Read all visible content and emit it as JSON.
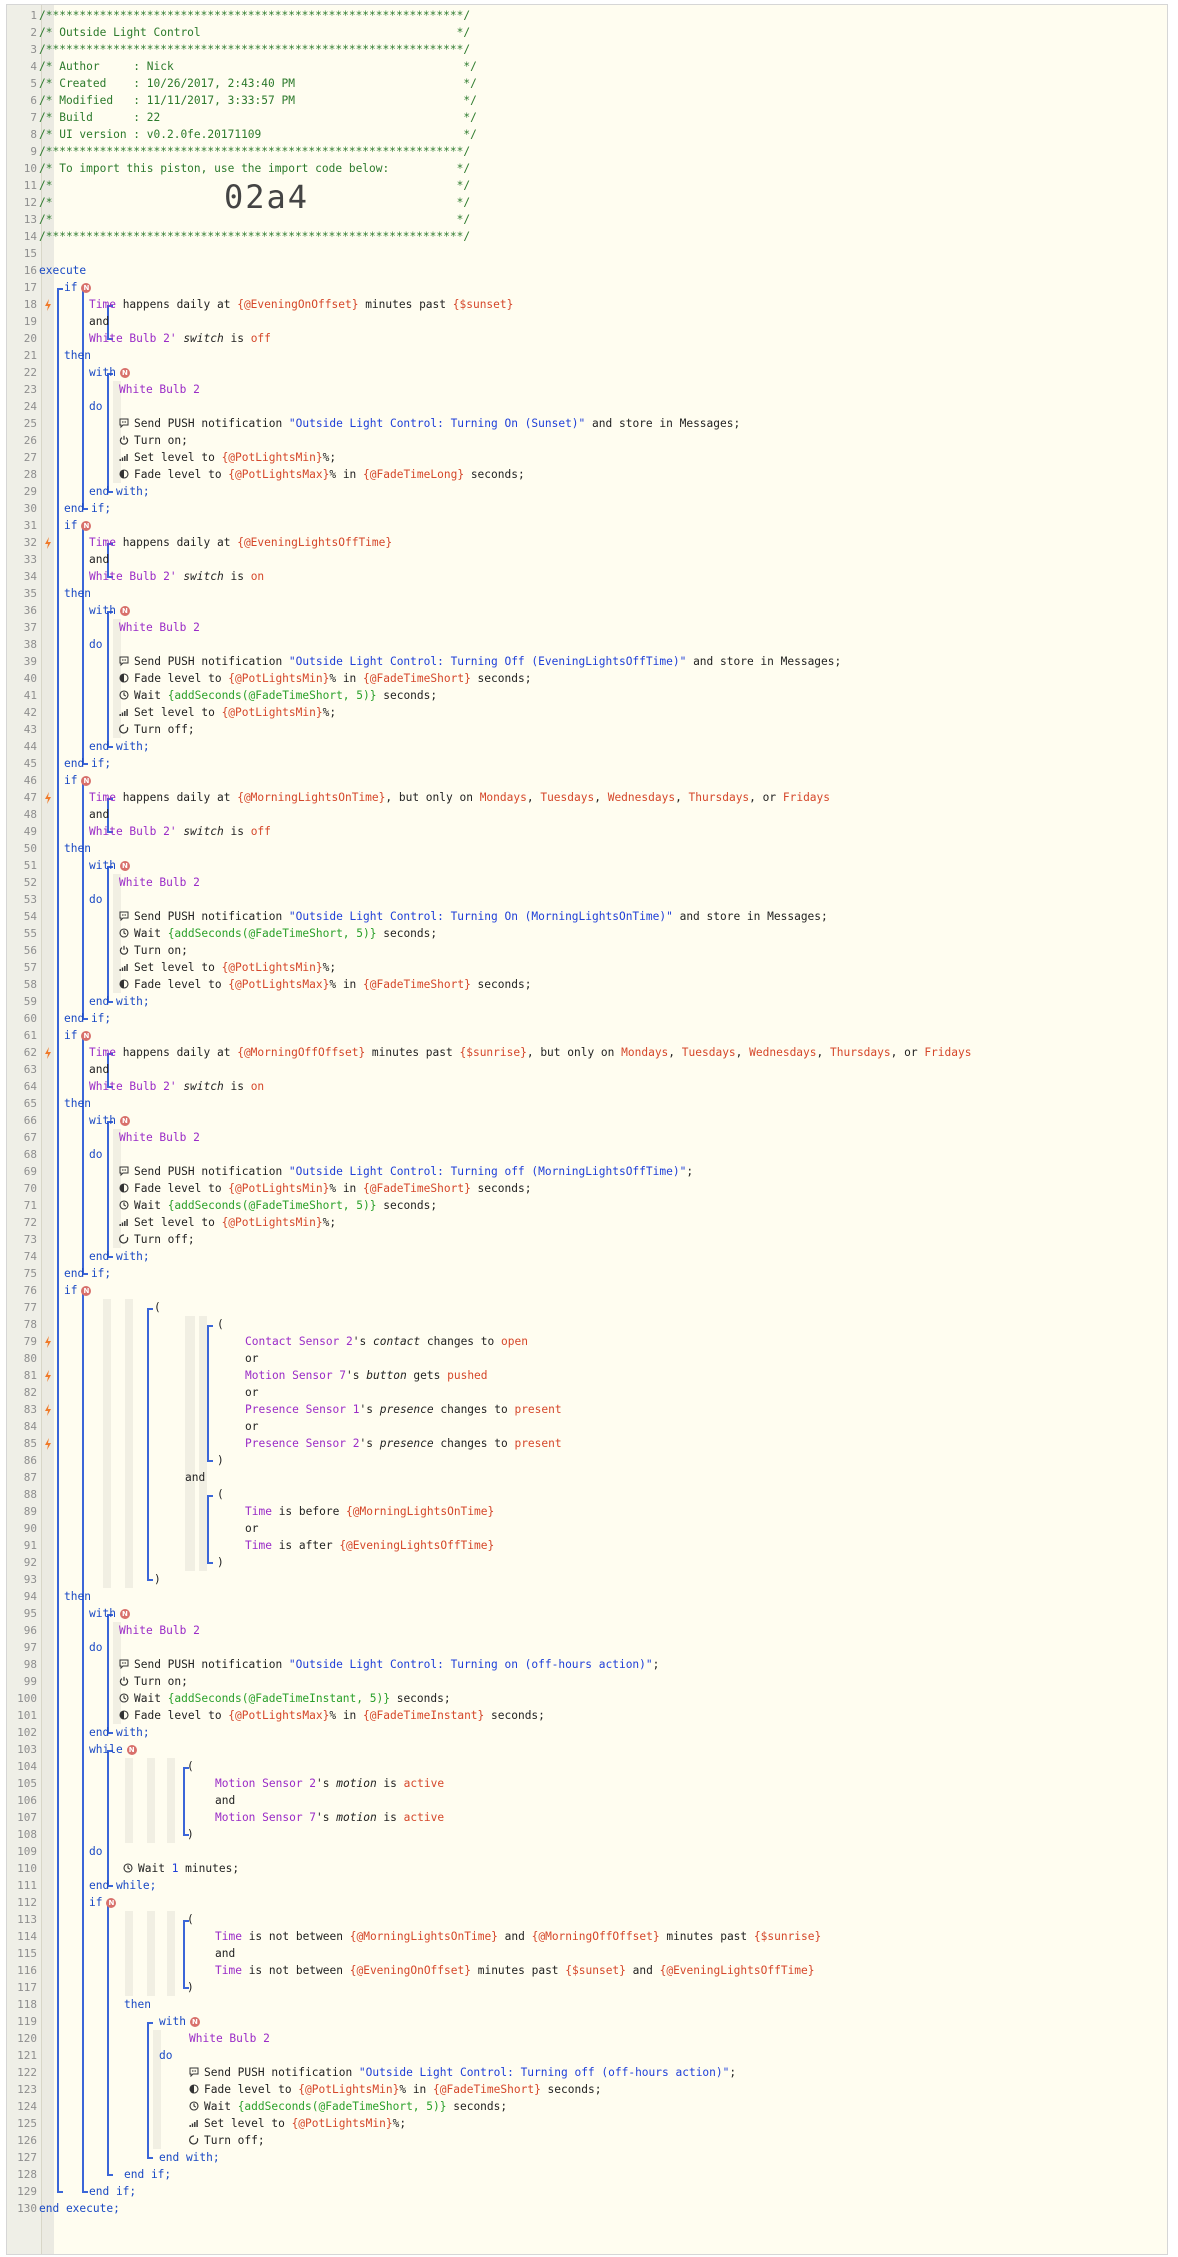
{
  "header": {
    "l1": "/**************************************************************/",
    "l2": "/* Outside Light Control                                      */",
    "l3": "/**************************************************************/",
    "l4": "/* Author     : Nick                                           */",
    "l5": "/* Created    : 10/26/2017, 2:43:40 PM                         */",
    "l6": "/* Modified   : 11/11/2017, 3:33:57 PM                         */",
    "l7": "/* Build      : 22                                             */",
    "l8": "/* UI version : v0.2.0fe.20171109                              */",
    "l9": "/**************************************************************/",
    "l10": "/* To import this piston, use the import code below:          */",
    "l11": "/*                                                            */",
    "l12": "/*                                                            */",
    "l13": "/*                                                            */",
    "l14": "/**************************************************************/",
    "import_code": "02a4"
  },
  "kw": {
    "execute": "execute",
    "end_execute": "end execute;",
    "if": "if",
    "then": "then",
    "end_if": "end if;",
    "with": "with",
    "do": "do",
    "end_with": "end with;",
    "and": "and",
    "or": "or",
    "while": "while",
    "end_while": "end while;",
    "open_paren": "(",
    "close_paren": ")"
  },
  "dev": {
    "time": "Time",
    "bulb": "White Bulb 2",
    "bulb_q": "White Bulb 2'",
    "contact": "Contact Sensor 2",
    "motion7": "Motion Sensor 7",
    "presence1": "Presence Sensor 1",
    "presence2": "Presence Sensor 2",
    "motion2": "Motion Sensor 2"
  },
  "vars": {
    "evening_on_offset": "{@EveningOnOffset}",
    "sunset": "{$sunset}",
    "sunrise": "{$sunrise}",
    "pot_min": "{@PotLightsMin}",
    "pot_max": "{@PotLightsMax}",
    "fade_long": "{@FadeTimeLong}",
    "fade_short": "{@FadeTimeShort}",
    "evening_off": "{@EveningLightsOffTime}",
    "morning_on": "{@MorningLightsOnTime}",
    "morning_off_offset": "{@MorningOffOffset}",
    "add_short": "{addSeconds(@FadeTimeShort, 5)}",
    "add_instant": "{addSeconds(@FadeTimeInstant, 5)}",
    "fade_instant": "{@FadeTimeInstant}"
  },
  "words": {
    "happens_daily_at": " happens daily at ",
    "minutes_past": " minutes past ",
    "switch": "switch",
    "is": " is ",
    "off": "off",
    "on": "on",
    "only_on": ", but only on ",
    "mondays": "Mondays",
    "tuesdays": "Tuesdays",
    "wednesdays": "Wednesdays",
    "thursdays": "Thursdays",
    "fridays": "Fridays",
    "comma": ", ",
    "or_word": ", or ",
    "send_push": "Send PUSH notification ",
    "store_msgs": " and store in Messages;",
    "semicolon": ";",
    "turn_on": "Turn on;",
    "turn_off": "Turn off;",
    "set_level": "Set level to ",
    "pct_semi": "%;",
    "fade_level": "Fade level to ",
    "pct_in": "% in ",
    "seconds": " seconds;",
    "wait": "Wait ",
    "s_apos": "'s ",
    "contact_w": "contact",
    "changes_to": " changes to ",
    "open": "open",
    "button_w": "button",
    "gets": " gets ",
    "pushed": "pushed",
    "presence_w": "presence",
    "present": "present",
    "is_before": " is before ",
    "is_after": " is after ",
    "motion_w": "motion",
    "active": "active",
    "wait_one": "1",
    "minutes": " minutes;",
    "is_not_between": " is not between ",
    "and_w": " and ",
    "msg_sunset": "\"Outside Light Control: Turning On (Sunset)\"",
    "msg_evening_off": "\"Outside Light Control: Turning Off (EveningLightsOffTime)\"",
    "msg_morning_on": "\"Outside Light Control: Turning On (MorningLightsOnTime)\"",
    "msg_morning_off": "\"Outside Light Control: Turning off (MorningLightsOffTime)\"",
    "msg_offhours_on": "\"Outside Light Control: Turning on (off-hours action)\"",
    "msg_offhours_off": "\"Outside Light Control: Turning off (off-hours action)\""
  },
  "colors": {
    "comment": "#2c7a2c",
    "keyword": "#1a49c4",
    "device": "#9a2bc7",
    "value": "#d5472a",
    "string": "#1f3fd8",
    "badge": "#d8706b",
    "trigger": "#f07a2a"
  },
  "icons": [
    "comment-bubble-icon",
    "power-icon",
    "signal-bars-icon",
    "toggle-icon",
    "timer-icon",
    "circle-off-icon",
    "lightning-icon",
    "condition-badge-icon"
  ]
}
